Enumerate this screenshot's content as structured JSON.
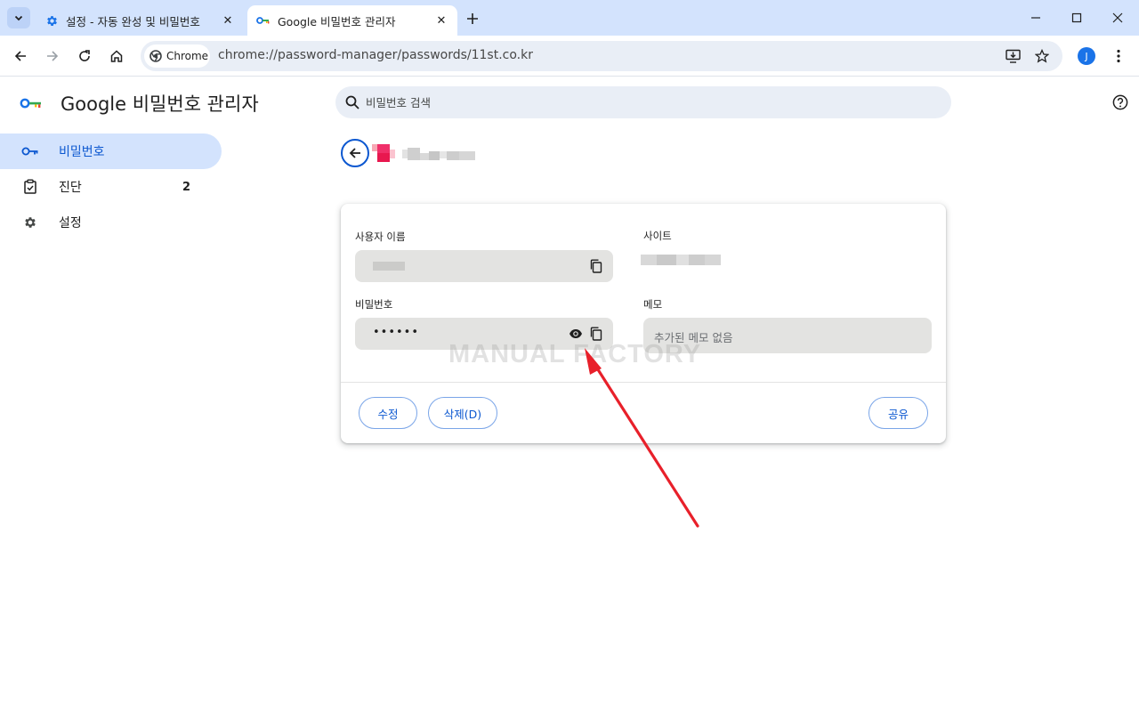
{
  "tabs": [
    {
      "title": "설정 - 자동 완성 및 비밀번호",
      "icon": "gear-icon",
      "active": false
    },
    {
      "title": "Google 비밀번호 관리자",
      "icon": "key-icon",
      "active": true
    }
  ],
  "toolbar": {
    "chip_label": "Chrome",
    "url": "chrome://password-manager/passwords/11st.co.kr",
    "avatar_letter": "J"
  },
  "app": {
    "title": "Google 비밀번호 관리자",
    "search_placeholder": "비밀번호 검색"
  },
  "sidebar": {
    "items": [
      {
        "label": "비밀번호",
        "icon": "key-icon",
        "selected": true
      },
      {
        "label": "진단",
        "icon": "checkup-icon",
        "count": "2"
      },
      {
        "label": "설정",
        "icon": "gear-icon"
      }
    ]
  },
  "detail": {
    "username_label": "사용자 이름",
    "site_label": "사이트",
    "password_label": "비밀번호",
    "password_mask": "••••••",
    "memo_label": "메모",
    "memo_placeholder": "추가된 메모 없음",
    "edit_button": "수정",
    "delete_button": "삭제(D)",
    "share_button": "공유"
  },
  "watermark": "MANUAL FACTORY",
  "colors": {
    "accent": "#0b57d0",
    "tabstrip": "#d3e3fd",
    "annotation_arrow": "#e8202a"
  }
}
